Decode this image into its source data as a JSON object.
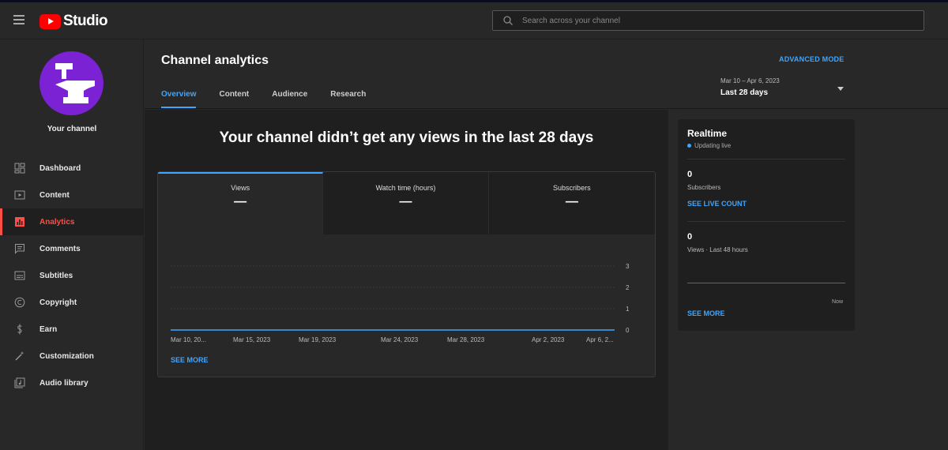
{
  "header": {
    "logo_text": "Studio",
    "search_placeholder": "Search across your channel"
  },
  "sidebar": {
    "channel_label": "Your channel",
    "items": [
      {
        "label": "Dashboard",
        "icon": "dashboard-icon"
      },
      {
        "label": "Content",
        "icon": "content-icon"
      },
      {
        "label": "Analytics",
        "icon": "analytics-icon",
        "active": true
      },
      {
        "label": "Comments",
        "icon": "comments-icon"
      },
      {
        "label": "Subtitles",
        "icon": "subtitles-icon"
      },
      {
        "label": "Copyright",
        "icon": "copyright-icon"
      },
      {
        "label": "Earn",
        "icon": "earn-icon"
      },
      {
        "label": "Customization",
        "icon": "customization-icon"
      },
      {
        "label": "Audio library",
        "icon": "audio-library-icon"
      }
    ]
  },
  "main": {
    "title": "Channel analytics",
    "advanced_mode": "ADVANCED MODE",
    "tabs": [
      "Overview",
      "Content",
      "Audience",
      "Research"
    ],
    "active_tab": "Overview",
    "date_range": "Mar 10 – Apr 6, 2023",
    "date_label": "Last 28 days",
    "no_views_message": "Your channel didn’t get any views in the last 28 days",
    "metrics": [
      {
        "label": "Views",
        "value": "—"
      },
      {
        "label": "Watch time (hours)",
        "value": "—"
      },
      {
        "label": "Subscribers",
        "value": "—"
      }
    ],
    "see_more": "SEE MORE"
  },
  "chart_data": {
    "type": "line",
    "x_tick_labels": [
      "Mar 10, 20...",
      "Mar 15, 2023",
      "Mar 19, 2023",
      "Mar 24, 2023",
      "Mar 28, 2023",
      "Apr 2, 2023",
      "Apr 6, 2..."
    ],
    "y_ticks": [
      0,
      1,
      2,
      3
    ],
    "ylim": [
      0,
      3
    ],
    "series": [
      {
        "values": [
          0,
          0,
          0,
          0,
          0,
          0,
          0
        ]
      }
    ],
    "line_color": "#3ea6ff",
    "grid": true
  },
  "realtime": {
    "title": "Realtime",
    "status": "Updating live",
    "subscribers_value": "0",
    "subscribers_label": "Subscribers",
    "live_count_link": "SEE LIVE COUNT",
    "views_value": "0",
    "views_label": "Views · Last 48 hours",
    "now_label": "Now",
    "see_more": "SEE MORE"
  },
  "colors": {
    "accent": "#3ea6ff",
    "active_nav": "#ff4e45",
    "brand_red": "#ff0000",
    "avatar": "#7b22d4"
  }
}
